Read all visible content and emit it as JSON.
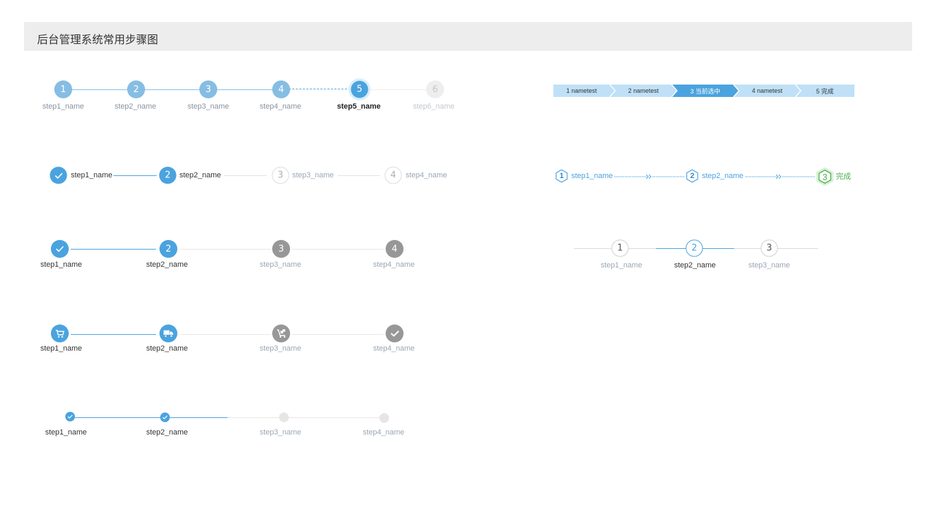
{
  "header": {
    "title": "后台管理系统常用步骤图"
  },
  "s1": {
    "nums": [
      "1",
      "2",
      "3",
      "4",
      "5",
      "6"
    ],
    "labels": [
      "step1_name",
      "step2_name",
      "step3_name",
      "step4_name",
      "step5_name",
      "step6_name"
    ]
  },
  "s2": {
    "nums": [
      "2",
      "3",
      "4"
    ],
    "labels": [
      "step1_name",
      "step2_name",
      "step3_name",
      "step4_name"
    ]
  },
  "s3": {
    "nums": [
      "2",
      "3",
      "4"
    ],
    "labels": [
      "step1_name",
      "step2_name",
      "step3_name",
      "step4_name"
    ]
  },
  "s4": {
    "labels": [
      "step1_name",
      "step2_name",
      "step3_name",
      "step4_name"
    ],
    "icons": [
      "cart-icon",
      "truck-icon",
      "delivery-icon",
      "check-icon"
    ]
  },
  "s5": {
    "labels": [
      "step1_name",
      "step2_name",
      "step3_name",
      "step4_name"
    ]
  },
  "breadcrumb": {
    "items": [
      "1 nametest",
      "2 nametest",
      "3 当前选中",
      "4 nametest",
      "5 完成"
    ],
    "active_index": 2
  },
  "hex": {
    "nums": [
      "1",
      "2",
      "3"
    ],
    "labels": [
      "step1_name",
      "step2_name",
      "完成"
    ]
  },
  "s7": {
    "nums": [
      "1",
      "2",
      "3"
    ],
    "labels": [
      "step1_name",
      "step2_name",
      "step3_name"
    ]
  },
  "colors": {
    "primary": "#4aa3df",
    "primary_light": "#86bde3",
    "active_line": "#5aaee3",
    "gray_circle": "#979797",
    "inactive_text": "#9aa6b5",
    "disabled_text": "#c2c8cf",
    "success": "#4caf50",
    "crumb_bg": "#bfe0f6"
  }
}
